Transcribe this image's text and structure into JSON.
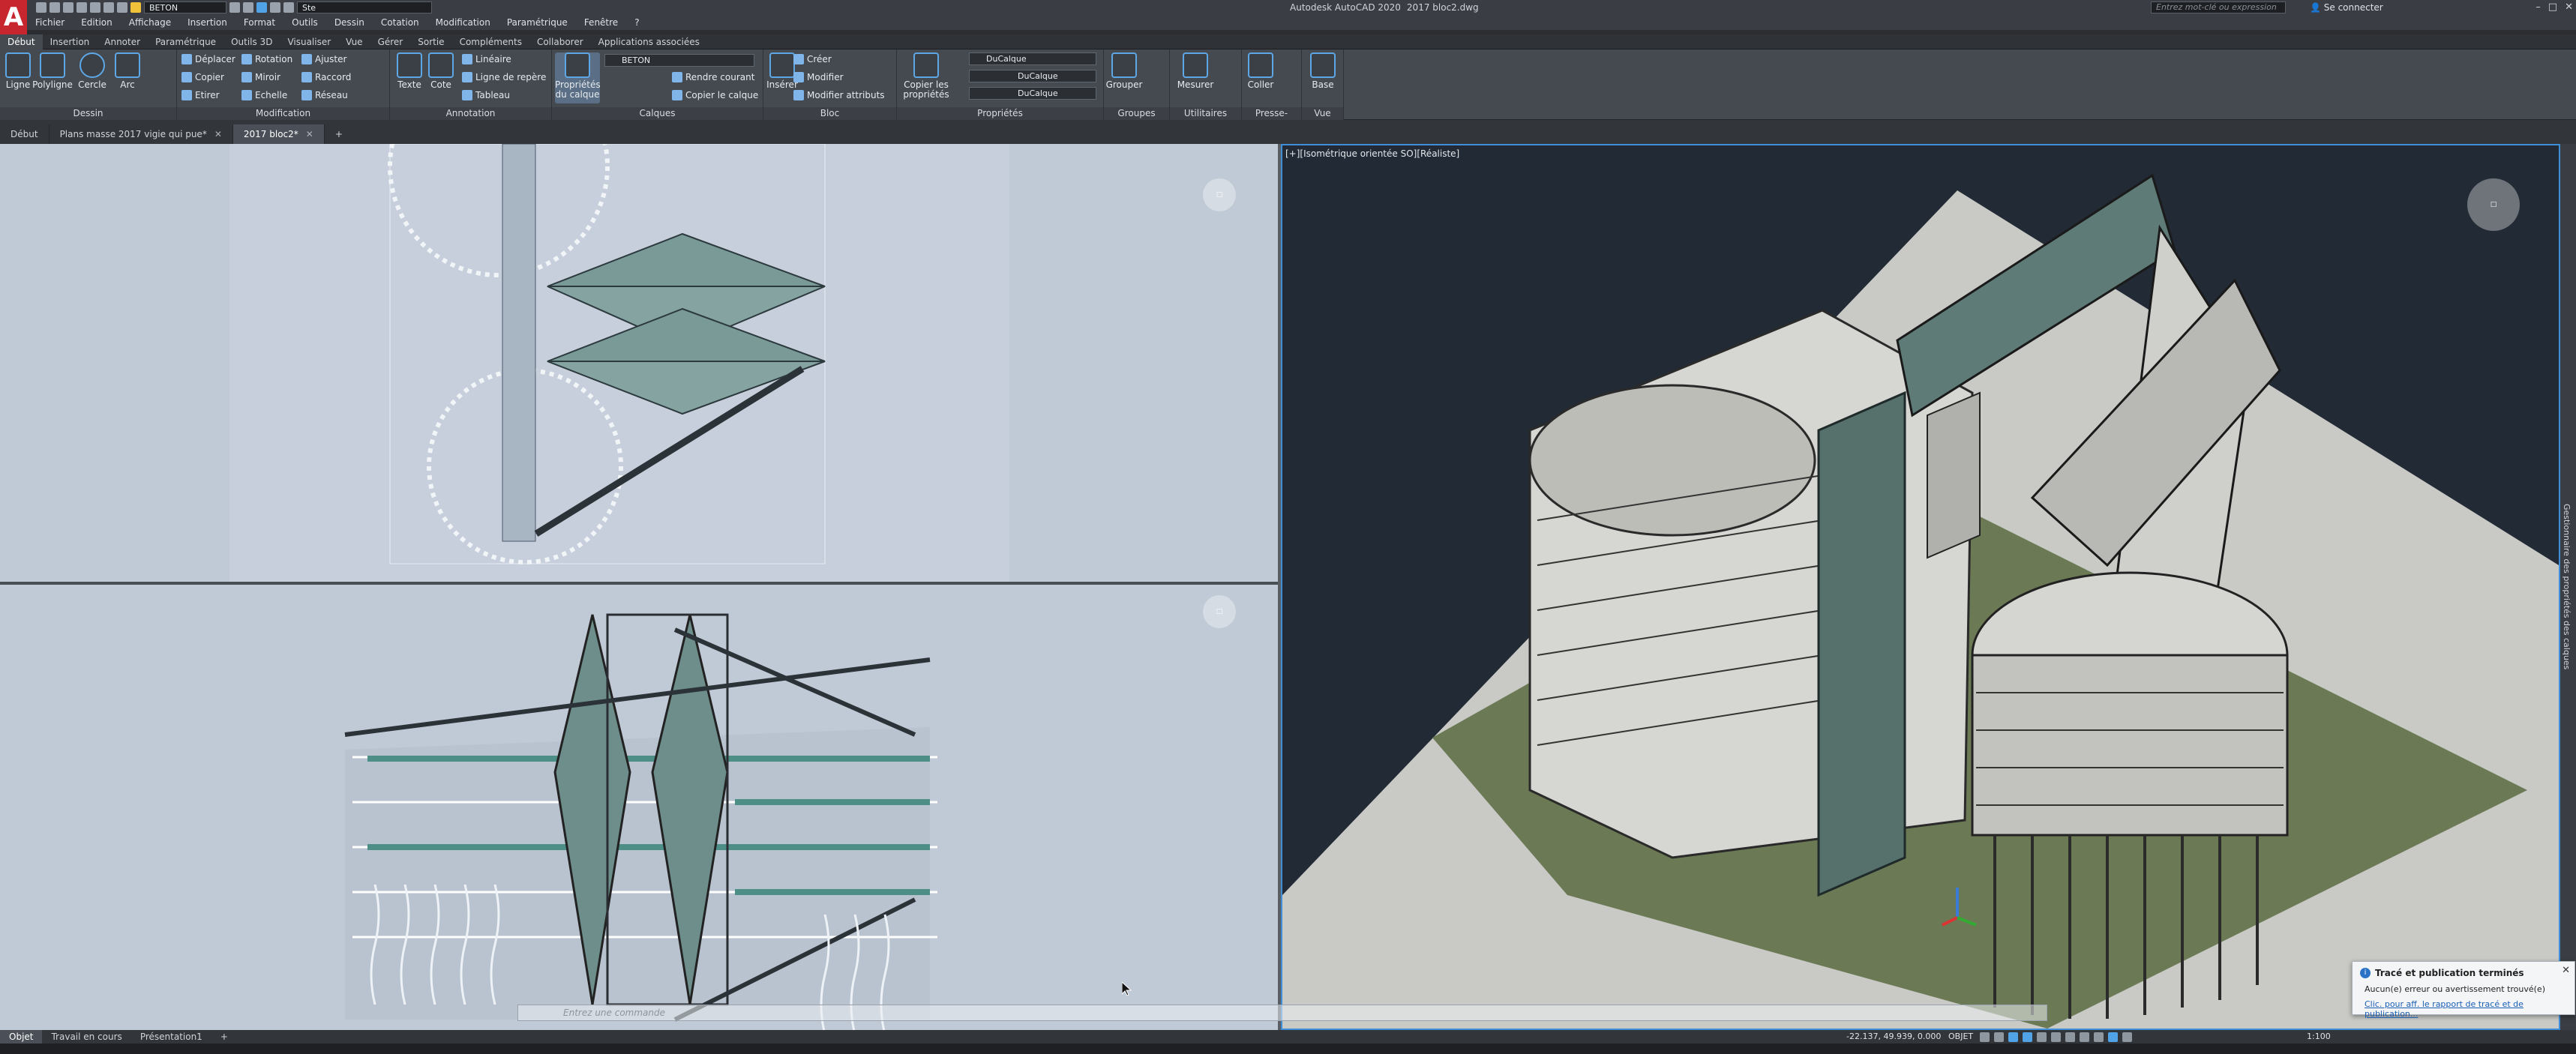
{
  "app": {
    "title": "Autodesk AutoCAD 2020",
    "file": "2017 bloc2.dwg",
    "logo": "A",
    "search_placeholder": "Entrez mot-clé ou expression",
    "signin": "Se connecter"
  },
  "qat": {
    "layer_combo": "BETON",
    "workspace_combo": "Ste"
  },
  "menu": [
    "Fichier",
    "Edition",
    "Affichage",
    "Insertion",
    "Format",
    "Outils",
    "Dessin",
    "Cotation",
    "Modification",
    "Paramétrique",
    "Fenêtre",
    "?"
  ],
  "ribbon_tabs": [
    "Début",
    "Insertion",
    "Annoter",
    "Paramétrique",
    "Outils 3D",
    "Visualiser",
    "Vue",
    "Gérer",
    "Sortie",
    "Compléments",
    "Collaborer",
    "Applications associées"
  ],
  "ribbon": {
    "dessin": {
      "title": "Dessin",
      "ligne": "Ligne",
      "polyligne": "Polyligne",
      "cercle": "Cercle",
      "arc": "Arc"
    },
    "modification": {
      "title": "Modification",
      "deplacer": "Déplacer",
      "rotation": "Rotation",
      "ajuster": "Ajuster",
      "copier": "Copier",
      "miroir": "Miroir",
      "raccord": "Raccord",
      "etirer": "Etirer",
      "echelle": "Echelle",
      "reseau": "Réseau"
    },
    "annotation": {
      "title": "Annotation",
      "texte": "Texte",
      "cote": "Cote",
      "lineaire": "Linéaire",
      "ligne_repere": "Ligne de repère",
      "tableau": "Tableau"
    },
    "calques": {
      "title": "Calques",
      "proprietes": "Propriétés du calque",
      "layer": "BETON",
      "rendre_courant": "Rendre courant",
      "copier_calque": "Copier le calque"
    },
    "bloc": {
      "title": "Bloc",
      "inserer": "Insérer",
      "creer": "Créer",
      "modifier": "Modifier",
      "modifier_attributs": "Modifier attributs"
    },
    "proprietes": {
      "title": "Propriétés",
      "copier": "Copier les propriétés",
      "color": "DuCalque",
      "linetype": "DuCalque",
      "lineweight": "DuCalque"
    },
    "groupes": {
      "title": "Groupes",
      "grouper": "Grouper"
    },
    "utilitaires": {
      "title": "Utilitaires",
      "mesurer": "Mesurer"
    },
    "presse": {
      "title": "Presse-papiers",
      "coller": "Coller"
    },
    "vue": {
      "title": "Vue",
      "base": "Base"
    }
  },
  "doc_tabs": [
    {
      "label": "Début",
      "closable": false
    },
    {
      "label": "Plans masse 2017 vigie qui pue*",
      "closable": true
    },
    {
      "label": "2017 bloc2*",
      "closable": true
    }
  ],
  "viewport3d_label": "[+][Isométrique orientée SO][Réaliste]",
  "palette_label": "Gestionnaire des propriétés des calques",
  "command_placeholder": "Entrez une commande",
  "layout_tabs": [
    "Objet",
    "Travail en cours",
    "Présentation1"
  ],
  "status": {
    "coords": "-22.137, 49.939, 0.000",
    "mode": "OBJET",
    "scale": "1:100"
  },
  "notification": {
    "title": "Tracé et publication terminés",
    "message": "Aucun(e) erreur ou avertissement trouvé(e)",
    "link": "Clic. pour aff. le rapport de tracé et de publication..."
  },
  "colors": {
    "accent": "#3f8fd8",
    "viewport_bg": "#c0c9d6",
    "dark_viewport": "#222a35"
  }
}
